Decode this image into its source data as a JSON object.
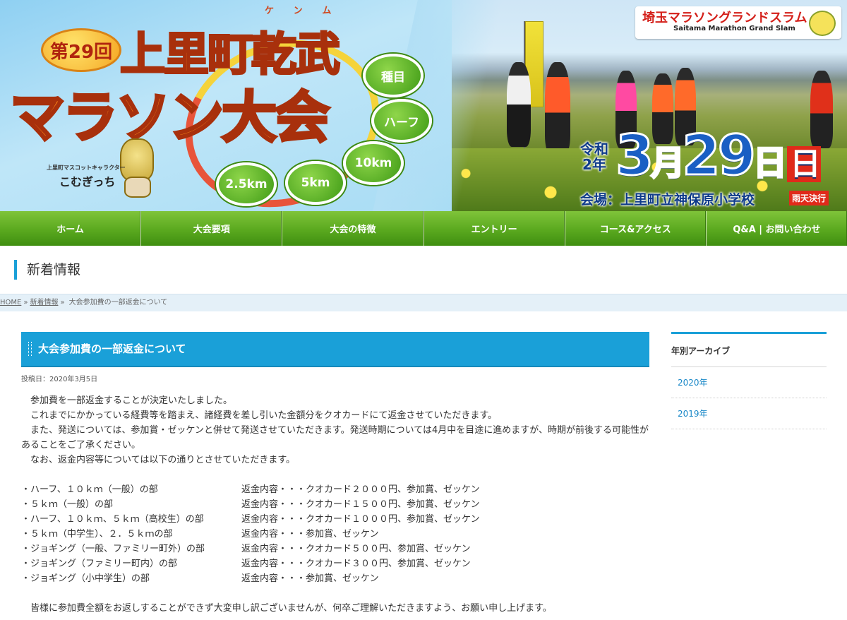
{
  "banner": {
    "edition": "第29回",
    "title_line1": "上里町乾武",
    "title_ruby": "ケンム",
    "title_line2": "マラソン大会",
    "events": [
      "種目",
      "ハーフ",
      "10km",
      "5km",
      "2.5km"
    ],
    "mascot_caption": "上里町マスコットキャラクター",
    "mascot_name": "こむぎっち",
    "grand_slam_title": "埼玉マラソングランドスラム",
    "grand_slam_sub": "Saitama Marathon Grand Slam",
    "era_line1": "令和",
    "era_line2": "2年",
    "date_month": "3",
    "date_month_unit": "月",
    "date_day": "29",
    "date_day_unit": "日",
    "date_weekday": "日",
    "venue": "会場：上里町立神保原小学校",
    "rain_note": "雨天決行"
  },
  "nav": {
    "items": [
      "ホーム",
      "大会要項",
      "大会の特徴",
      "エントリー",
      "コース&アクセス",
      "Q&A | お問い合わせ"
    ]
  },
  "page": {
    "heading": "新着情報"
  },
  "breadcrumb": {
    "home": "HOME",
    "sep": "»",
    "news": "新着情報",
    "current": "大会参加費の一部返金について"
  },
  "post": {
    "title": "大会参加費の一部返金について",
    "date": "投稿日：2020年3月5日",
    "paragraphs": [
      "参加費を一部返金することが決定いたしました。",
      "これまでにかかっている経費等を踏まえ、諸経費を差し引いた金額分をクオカードにて返金させていただきます。",
      "また、発送については、参加賞・ゼッケンと併せて発送させていただきます。発送時期については4月中を目途に進めますが、時期が前後する可能性があることをご了承ください。",
      "なお、返金内容等については以下の通りとさせていただきます。"
    ],
    "fees": [
      {
        "category": "・ハーフ、１０ｋｍ（一般）の部",
        "refund": "返金内容・・・クオカード２０００円、参加賞、ゼッケン"
      },
      {
        "category": "・５ｋｍ（一般）の部",
        "refund": "返金内容・・・クオカード１５００円、参加賞、ゼッケン"
      },
      {
        "category": "・ハーフ、１０ｋｍ、５ｋｍ（高校生）の部",
        "refund": "返金内容・・・クオカード１０００円、参加賞、ゼッケン"
      },
      {
        "category": "・５ｋｍ（中学生）、２．５ｋｍの部",
        "refund": "返金内容・・・参加賞、ゼッケン"
      },
      {
        "category": "・ジョギング（一般、ファミリー町外）の部",
        "refund": "返金内容・・・クオカード５００円、参加賞、ゼッケン"
      },
      {
        "category": "・ジョギング（ファミリー町内）の部",
        "refund": "返金内容・・・クオカード３００円、参加賞、ゼッケン"
      },
      {
        "category": "・ジョギング（小中学生）の部",
        "refund": "返金内容・・・参加賞、ゼッケン"
      }
    ],
    "closing": "皆様に参加費全額をお返しすることができず大変申し訳ございませんが、何卒ご理解いただきますよう、お願い申し上げます。"
  },
  "sidebar": {
    "heading": "年別アーカイブ",
    "items": [
      "2020年",
      "2019年"
    ]
  },
  "colors": {
    "accent_blue": "#1aa0d8",
    "nav_green": "#5aa91f",
    "link_blue": "#1a88c8"
  }
}
